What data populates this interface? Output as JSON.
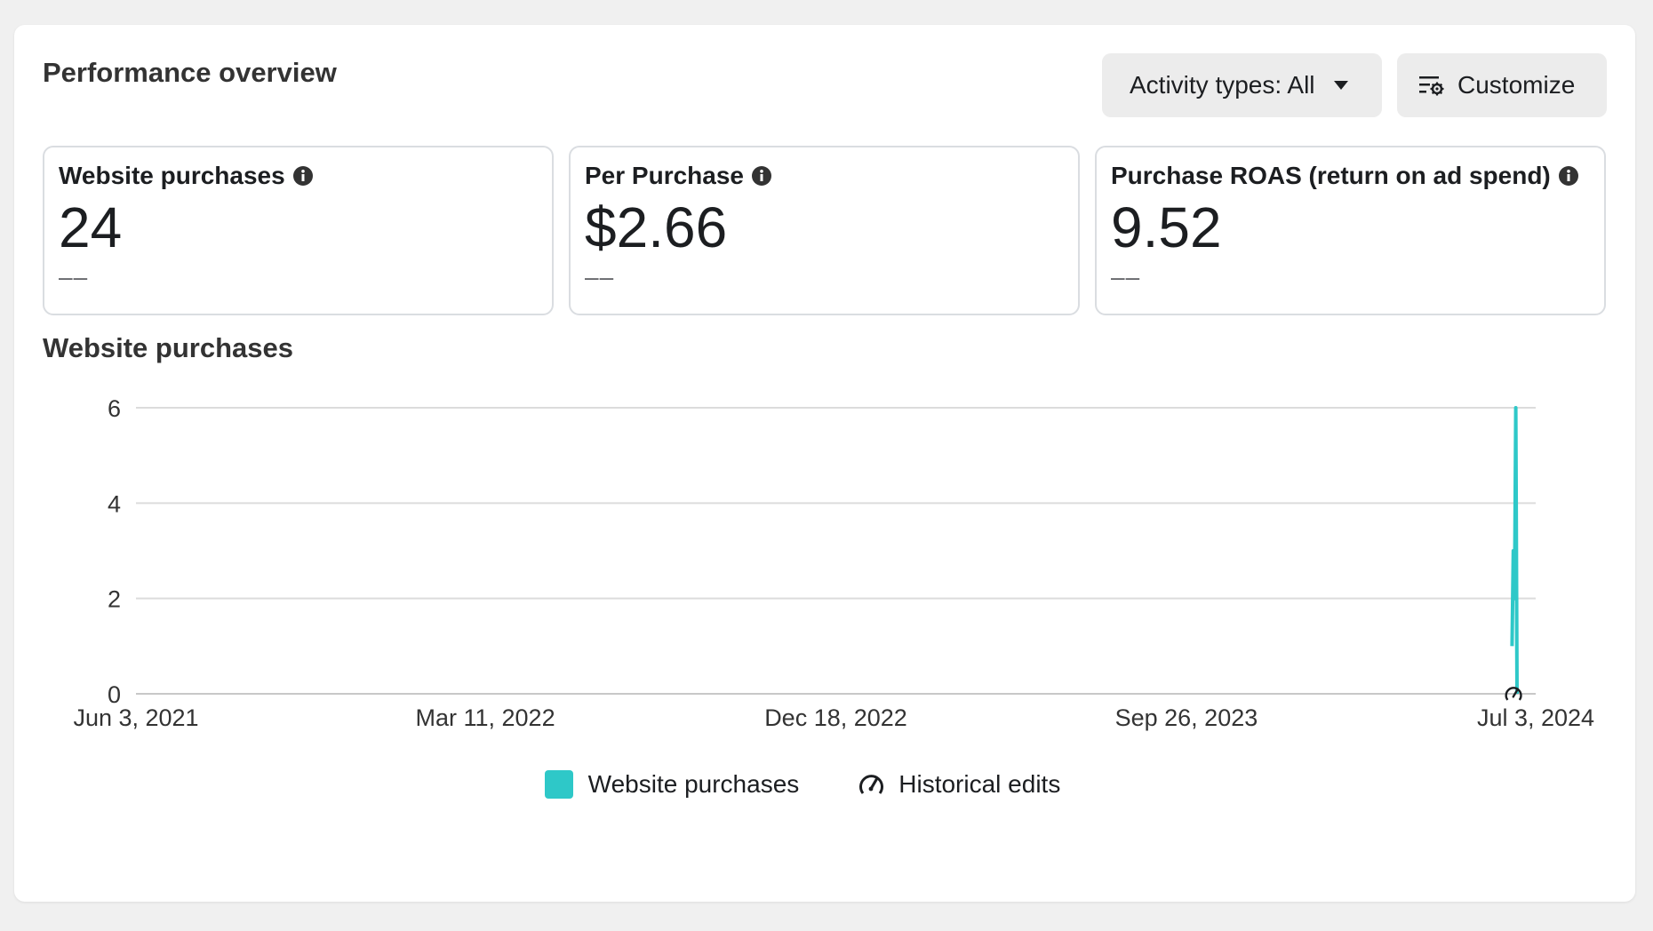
{
  "header": {
    "title": "Performance overview",
    "activity_label": "Activity types: All",
    "customize_label": "Customize"
  },
  "metrics": [
    {
      "label": "Website purchases",
      "value": "24",
      "delta": "––"
    },
    {
      "label": "Per Purchase",
      "value": "$2.66",
      "delta": "––"
    },
    {
      "label": "Purchase ROAS (return on ad spend)",
      "value": "9.52",
      "delta": "––"
    }
  ],
  "chart_title": "Website purchases",
  "chart_data": {
    "type": "line",
    "title": "Website purchases",
    "xlabel": "",
    "ylabel": "",
    "x_range": [
      "2021-06-03",
      "2024-07-03"
    ],
    "ylim": [
      0,
      6
    ],
    "y_ticks": [
      "0",
      "2",
      "4",
      "6"
    ],
    "x_ticks": [
      {
        "date": "2021-06-03",
        "label": "Jun 3, 2021"
      },
      {
        "date": "2022-03-11",
        "label": "Mar 11, 2022"
      },
      {
        "date": "2022-12-18",
        "label": "Dec 18, 2022"
      },
      {
        "date": "2023-09-26",
        "label": "Sep 26, 2023"
      },
      {
        "date": "2024-07-03",
        "label": "Jul 3, 2024"
      }
    ],
    "grid": true,
    "legend_position": "bottom-center",
    "series": [
      {
        "name": "Website purchases",
        "color": "#2ec8c8",
        "points": [
          {
            "x": "2024-06-14",
            "y": 1
          },
          {
            "x": "2024-06-15",
            "y": 3
          },
          {
            "x": "2024-06-16",
            "y": 2
          },
          {
            "x": "2024-06-17",
            "y": 6
          },
          {
            "x": "2024-06-18",
            "y": 0
          }
        ]
      }
    ],
    "annotations": [
      {
        "type": "historical-edit",
        "x": "2024-06-15"
      }
    ]
  },
  "legend": [
    {
      "label": "Website purchases",
      "color": "#2ec8c8",
      "icon": "swatch"
    },
    {
      "label": "Historical edits",
      "icon": "historical-edit-icon"
    }
  ]
}
